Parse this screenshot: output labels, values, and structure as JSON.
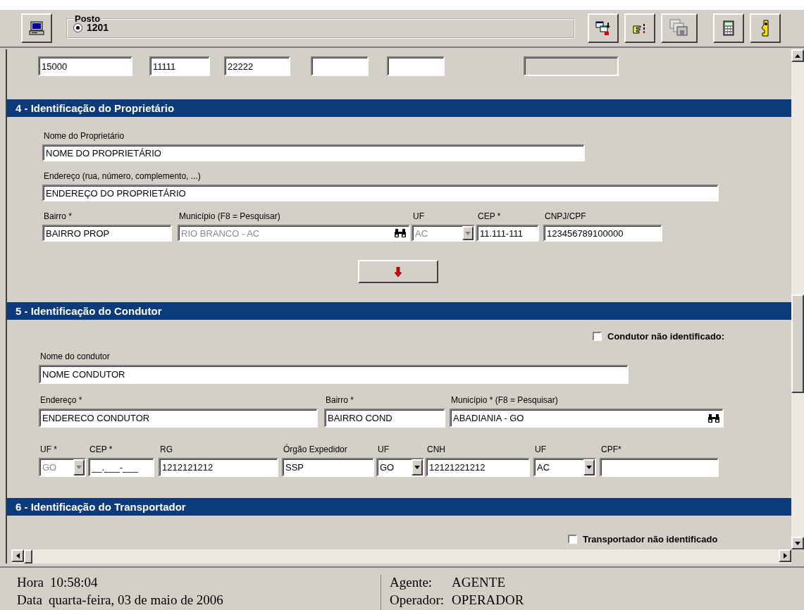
{
  "toolbar": {
    "posto": {
      "legend": "Posto",
      "options": [
        {
          "label": "1201",
          "selected": true
        }
      ]
    }
  },
  "top_fields": [
    {
      "value": "15000",
      "disabled": false
    },
    {
      "value": "11111",
      "disabled": false
    },
    {
      "value": "22222",
      "disabled": false
    },
    {
      "disabled": false
    },
    {
      "disabled": false
    },
    {
      "disabled": true
    }
  ],
  "sections": [
    {
      "title": "4 - Identificação do Proprietário",
      "rows": [
        {
          "fields": [
            {
              "label": "Nome do Proprietário",
              "value": "NOME DO PROPRIETÁRIO",
              "kind": "text",
              "disabled": false
            }
          ]
        },
        {
          "fields": [
            {
              "label": "Endereço (rua, número, complemento, ...)",
              "value": "ENDEREÇO DO PROPRIETÁRIO",
              "kind": "text",
              "disabled": false
            }
          ]
        },
        {
          "fields": [
            {
              "label": "Bairro *",
              "value": "BAIRRO PROP",
              "kind": "text",
              "disabled": false
            },
            {
              "label": "Município (F8 = Pesquisar)",
              "value": "RIO BRANCO - AC",
              "kind": "search",
              "disabled": true
            },
            {
              "label": "UF",
              "value": "AC",
              "kind": "select",
              "disabled": true
            },
            {
              "label": "CEP *",
              "value": "11.111-111",
              "kind": "text",
              "disabled": false
            },
            {
              "label": "CNPJ/CPF",
              "value": "123456789100000",
              "kind": "text",
              "disabled": false
            }
          ]
        }
      ]
    },
    {
      "title": "5 - Identificação do Condutor",
      "checkbox": {
        "label": "Condutor não identificado:",
        "checked": false
      },
      "rows": [
        {
          "fields": [
            {
              "label": "Nome do condutor",
              "value": "NOME CONDUTOR",
              "kind": "text",
              "disabled": false
            }
          ]
        },
        {
          "fields": [
            {
              "label": "Endereço *",
              "value": "ENDERECO CONDUTOR",
              "kind": "text",
              "disabled": false
            },
            {
              "label": "Bairro *",
              "value": "BAIRRO COND",
              "kind": "text",
              "disabled": false
            },
            {
              "label": "Município * (F8 = Pesquisar)",
              "value": "ABADIANIA - GO",
              "kind": "search",
              "disabled": false
            }
          ]
        },
        {
          "fields": [
            {
              "label": "UF *",
              "value": "GO",
              "kind": "select",
              "disabled": true
            },
            {
              "label": "CEP *",
              "value": "__.___-___",
              "kind": "text",
              "disabled": false
            },
            {
              "label": "RG",
              "value": "1212121212",
              "kind": "text",
              "disabled": false
            },
            {
              "label": "Órgão Expedidor",
              "value": "SSP",
              "kind": "text",
              "disabled": false
            },
            {
              "label": "UF",
              "value": "GO",
              "kind": "select",
              "disabled": false
            },
            {
              "label": "CNH",
              "value": "12121221212",
              "kind": "text",
              "disabled": false
            },
            {
              "label": "UF",
              "value": "AC",
              "kind": "select",
              "disabled": false
            },
            {
              "label": "CPF*",
              "kind": "text",
              "disabled": false
            }
          ]
        }
      ]
    },
    {
      "title": "6 - Identificação do Transportador",
      "checkbox": {
        "label": "Transportador não identificado",
        "checked": false
      }
    }
  ],
  "status_bar": {
    "hora_label": "Hora",
    "hora": "10:58:04",
    "data_label": "Data",
    "data": "quarta-feira, 03 de maio de 2006",
    "agente_label": "Agente:",
    "agente": "AGENTE",
    "operador_label": "Operador:",
    "operador": "OPERADOR"
  }
}
